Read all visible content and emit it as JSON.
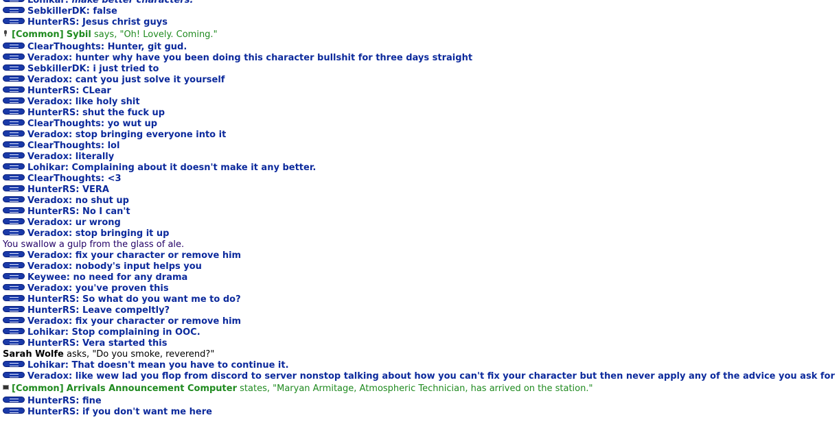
{
  "chat": {
    "lines": [
      {
        "type": "ooc",
        "sender": "Lohikar",
        "message": "make better characters.",
        "italic": true
      },
      {
        "type": "ooc",
        "sender": "SebkillerDK",
        "message": "false"
      },
      {
        "type": "ooc",
        "sender": "HunterRS",
        "message": "Jesus christ guys"
      },
      {
        "type": "radio",
        "icon": "mic",
        "channel": "[Common]",
        "speaker": "Sybil",
        "verb": "says,",
        "message": "\"Oh! Lovely. Coming.\""
      },
      {
        "type": "ooc",
        "sender": "ClearThoughts",
        "message": "Hunter, git gud."
      },
      {
        "type": "ooc",
        "sender": "Veradox",
        "message": "hunter why have you been doing this character bullshit for three days straight"
      },
      {
        "type": "ooc",
        "sender": "SebkillerDK",
        "message": "i just tried to"
      },
      {
        "type": "ooc",
        "sender": "Veradox",
        "message": "cant you just solve it yourself"
      },
      {
        "type": "ooc",
        "sender": "HunterRS",
        "message": "CLear"
      },
      {
        "type": "ooc",
        "sender": "Veradox",
        "message": "like holy shit"
      },
      {
        "type": "ooc",
        "sender": "HunterRS",
        "message": "shut the fuck up"
      },
      {
        "type": "ooc",
        "sender": "ClearThoughts",
        "message": "yo wut up"
      },
      {
        "type": "ooc",
        "sender": "Veradox",
        "message": "stop bringing everyone into it"
      },
      {
        "type": "ooc",
        "sender": "ClearThoughts",
        "message": "lol"
      },
      {
        "type": "ooc",
        "sender": "Veradox",
        "message": "literally"
      },
      {
        "type": "ooc",
        "sender": "Lohikar",
        "message": "Complaining about it doesn't make it any better."
      },
      {
        "type": "ooc",
        "sender": "ClearThoughts",
        "message": "<3"
      },
      {
        "type": "ooc",
        "sender": "HunterRS",
        "message": "VERA"
      },
      {
        "type": "ooc",
        "sender": "Veradox",
        "message": "no shut up"
      },
      {
        "type": "ooc",
        "sender": "HunterRS",
        "message": "No I can't"
      },
      {
        "type": "ooc",
        "sender": "Veradox",
        "message": "ur wrong"
      },
      {
        "type": "ooc",
        "sender": "Veradox",
        "message": "stop bringing it up"
      },
      {
        "type": "emote",
        "message": "You swallow a gulp from the glass of ale."
      },
      {
        "type": "ooc",
        "sender": "Veradox",
        "message": "fix your character or remove him"
      },
      {
        "type": "ooc",
        "sender": "Veradox",
        "message": "nobody's input helps you"
      },
      {
        "type": "ooc",
        "sender": "Keywee",
        "message": "no need for any drama"
      },
      {
        "type": "ooc",
        "sender": "Veradox",
        "message": "you've proven this"
      },
      {
        "type": "ooc",
        "sender": "HunterRS",
        "message": "So what do you want me to do?"
      },
      {
        "type": "ooc",
        "sender": "HunterRS",
        "message": "Leave compeltly?"
      },
      {
        "type": "ooc",
        "sender": "Veradox",
        "message": "fix your character or remove him"
      },
      {
        "type": "ooc",
        "sender": "Lohikar",
        "message": "Stop complaining in OOC."
      },
      {
        "type": "ooc",
        "sender": "HunterRS",
        "message": "Vera started this"
      },
      {
        "type": "local",
        "speaker": "Sarah Wolfe",
        "verb": "asks,",
        "message": "\"Do you smoke, reverend?\""
      },
      {
        "type": "ooc",
        "sender": "Lohikar",
        "message": "That doesn't mean you have to continue it."
      },
      {
        "type": "ooc",
        "sender": "Veradox",
        "message": "like wew lad you flop from discord to server nonstop talking about how you can't fix your character but then never apply any of the advice you ask for"
      },
      {
        "type": "radio",
        "icon": "box",
        "channel": "[Common]",
        "speaker": "Arrivals Announcement Computer",
        "verb": "states,",
        "message": "\"Maryan Armitage, Atmospheric Technician, has arrived on the station.\""
      },
      {
        "type": "ooc",
        "sender": "HunterRS",
        "message": "fine"
      },
      {
        "type": "ooc",
        "sender": "HunterRS",
        "message": "if you don't want me here"
      }
    ]
  }
}
